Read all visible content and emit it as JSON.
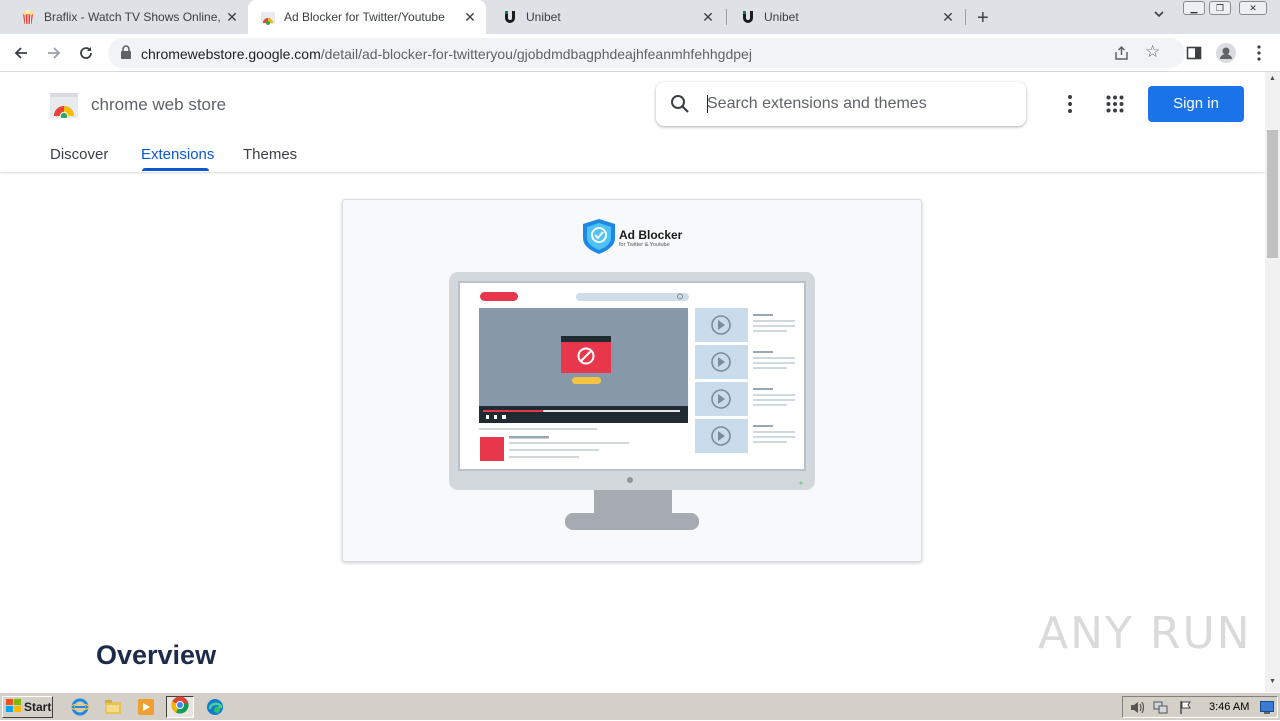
{
  "browser": {
    "tabs": [
      {
        "title": "Braflix - Watch TV Shows Online, Wa",
        "icon": "popcorn-icon"
      },
      {
        "title": "Ad Blocker for Twitter/Youtube",
        "icon": "chrome-web-store-icon"
      },
      {
        "title": "Unibet",
        "icon": "unibet-icon"
      },
      {
        "title": "Unibet",
        "icon": "unibet-icon"
      }
    ],
    "url_domain": "chromewebstore.google.com",
    "url_path": "/detail/ad-blocker-for-twitteryou/gjobdmdbagphdeajhfeanmhfehhgdpej"
  },
  "store": {
    "brand": "chrome web store",
    "search_placeholder": "Search extensions and themes",
    "signin_label": "Sign in",
    "nav": [
      "Discover",
      "Extensions",
      "Themes"
    ],
    "active_nav": "Extensions"
  },
  "content": {
    "promo_title": "Ad Blocker",
    "promo_subtitle": "for Twitter & Youtube",
    "overview_heading": "Overview"
  },
  "watermark": "ANY RUN",
  "taskbar": {
    "start_label": "Start",
    "clock": "3:46 AM"
  },
  "colors": {
    "accent": "#1a73e8",
    "active_tab_text": "#0b57d0",
    "ad_red": "#e8364b"
  }
}
